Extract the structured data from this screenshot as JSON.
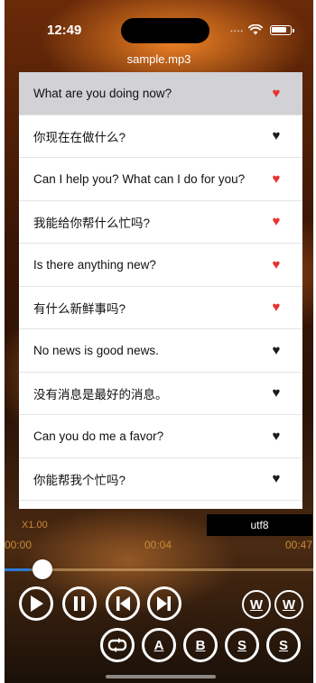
{
  "status_bar": {
    "time": "12:49"
  },
  "file": {
    "name": "sample.mp3"
  },
  "phrases": [
    {
      "text": "What are you doing now?",
      "favorite": true,
      "selected": true
    },
    {
      "text": "你现在在做什么?",
      "favorite": false,
      "selected": false
    },
    {
      "text": "Can I help you? What can I do for you?",
      "favorite": true,
      "selected": false
    },
    {
      "text": "我能给你帮什么忙吗?",
      "favorite": true,
      "selected": false
    },
    {
      "text": "Is there anything new?",
      "favorite": true,
      "selected": false
    },
    {
      "text": "有什么新鲜事吗?",
      "favorite": true,
      "selected": false
    },
    {
      "text": "No news is good news.",
      "favorite": false,
      "selected": false
    },
    {
      "text": "没有消息是最好的消息。",
      "favorite": false,
      "selected": false
    },
    {
      "text": "Can you do me a favor?",
      "favorite": false,
      "selected": false
    },
    {
      "text": "你能帮我个忙吗?",
      "favorite": false,
      "selected": false
    }
  ],
  "player": {
    "encoding": "utf8",
    "speed": "X1.00",
    "time_start": "00:00",
    "time_current": "00:04",
    "time_end": "00:47",
    "progress": 0.085
  },
  "controls": {
    "word_left": "W",
    "word_right": "W",
    "loop_a": "A",
    "loop_b": "B",
    "sentence_left": "S",
    "sentence_right": "S"
  },
  "colors": {
    "favorite": "#e8322e",
    "not_favorite": "#1b1b1b",
    "selected_row": "#d1d1d6",
    "time_text": "#c98a38"
  }
}
